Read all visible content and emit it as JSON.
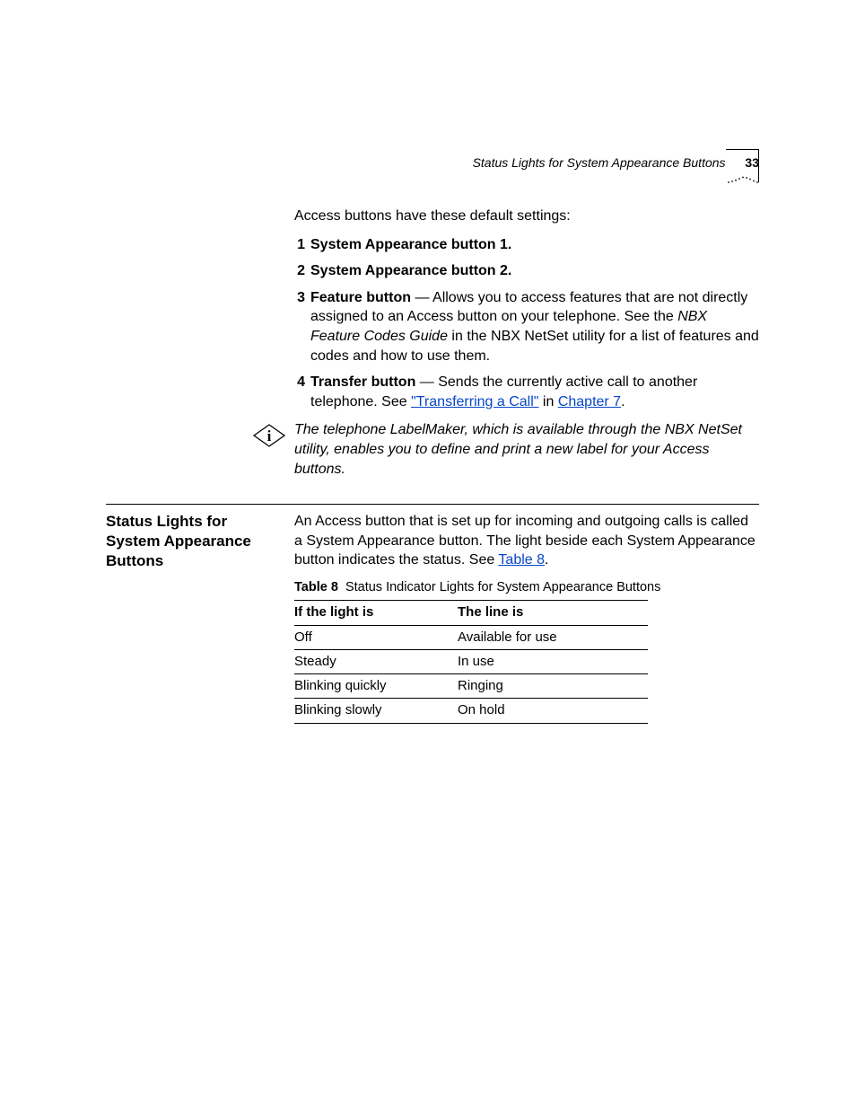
{
  "header": {
    "running_title": "Status Lights for System Appearance Buttons",
    "page_number": "33"
  },
  "intro_para": "Access buttons have these default settings:",
  "list": [
    {
      "num": "1",
      "bold": "System Appearance button 1."
    },
    {
      "num": "2",
      "bold": "System Appearance button 2."
    },
    {
      "num": "3",
      "bold": "Feature button",
      "dash": " — ",
      "text1": "Allows you to access features that are not directly assigned to an Access button on your telephone. See the ",
      "ital": "NBX Feature Codes Guide",
      "text2": " in the NBX NetSet utility for a list of features and codes and how to use them."
    },
    {
      "num": "4",
      "bold": "Transfer button",
      "dash": " — ",
      "text1": "Sends the currently active call to another telephone. See ",
      "link1": "\"Transferring a Call\"",
      "mid": " in ",
      "link2": "Chapter 7",
      "tail": "."
    }
  ],
  "note": "The telephone LabelMaker, which is available through the NBX NetSet utility, enables you to define and print a new label for your Access buttons.",
  "section": {
    "heading": "Status Lights for System Appearance Buttons",
    "body1": "An Access button that is set up for incoming and outgoing calls is called a System Appearance button. The light beside each System Appearance button indicates the status. See ",
    "body_link": "Table 8",
    "body_tail": "."
  },
  "table": {
    "label": "Table 8",
    "caption": "Status Indicator Lights for System Appearance Buttons",
    "head": [
      "If the light is",
      "The line is"
    ],
    "rows": [
      [
        "Off",
        "Available for use"
      ],
      [
        "Steady",
        "In use"
      ],
      [
        "Blinking quickly",
        "Ringing"
      ],
      [
        "Blinking slowly",
        "On hold"
      ]
    ]
  }
}
